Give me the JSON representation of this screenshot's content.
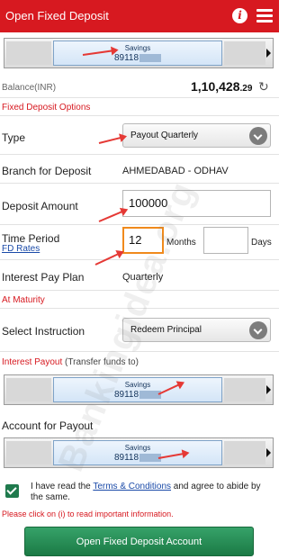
{
  "header": {
    "title": "Open Fixed Deposit",
    "info_icon": "info-icon",
    "menu_icon": "menu-icon",
    "color": "#d71920"
  },
  "from_account": {
    "type": "Savings",
    "number": "89118"
  },
  "balance": {
    "label": "Balance(INR)",
    "value": "1,10,428",
    "decimals": ".29"
  },
  "fd_options": {
    "section_label": "Fixed Deposit Options",
    "type_label": "Type",
    "type_value": "Payout Quarterly",
    "branch_label": "Branch for Deposit",
    "branch_value": "AHMEDABAD - ODHAV",
    "amount_label": "Deposit Amount",
    "amount_value": "100000",
    "period_label": "Time Period",
    "fd_rates_link": "FD Rates",
    "months_value": "12",
    "months_label": "Months",
    "days_value": "",
    "days_label": "Days",
    "pay_plan_label": "Interest Pay Plan",
    "pay_plan_value": "Quarterly"
  },
  "maturity": {
    "section_label": "At Maturity",
    "instruction_label": "Select Instruction",
    "instruction_value": "Redeem Principal"
  },
  "interest_payout": {
    "section_label": "Interest Payout",
    "section_note": "(Transfer funds to)",
    "account": {
      "type": "Savings",
      "number": "89118"
    }
  },
  "payout_account": {
    "label": "Account for Payout",
    "account": {
      "type": "Savings",
      "number": "89118"
    }
  },
  "terms": {
    "prefix": "I have read the ",
    "link": "Terms & Conditions",
    "suffix": " and agree to abide by the same.",
    "checked": true
  },
  "warning": "Please click on (i) to read important information.",
  "submit_label": "Open Fixed Deposit Account",
  "watermark": "Bankingidea.org"
}
